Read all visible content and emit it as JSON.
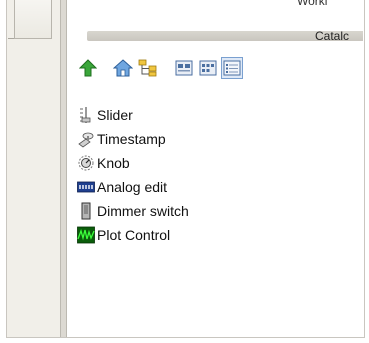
{
  "header": {
    "top_partial": "Workl",
    "catalog_label": "Catalc"
  },
  "toolbar": {
    "buttons": [
      {
        "icon": "green-up-arrow-icon"
      },
      {
        "icon": "home-icon"
      },
      {
        "icon": "tree-icon"
      },
      {
        "icon": "large-icons-view-icon"
      },
      {
        "icon": "small-icons-view-icon"
      },
      {
        "icon": "list-view-icon",
        "active": true
      }
    ]
  },
  "items": [
    {
      "label": "Slider",
      "icon": "slider-icon"
    },
    {
      "label": "Timestamp",
      "icon": "timestamp-icon"
    },
    {
      "label": "Knob",
      "icon": "knob-icon"
    },
    {
      "label": "Analog edit",
      "icon": "analog-edit-icon"
    },
    {
      "label": "Dimmer switch",
      "icon": "dimmer-switch-icon"
    },
    {
      "label": "Plot Control",
      "icon": "plot-control-icon"
    }
  ],
  "colors": {
    "panel": "#f1efe9",
    "accent": "#7aa0d0",
    "plot_bg": "#0b5d0b",
    "plot_line": "#3cff3c"
  }
}
